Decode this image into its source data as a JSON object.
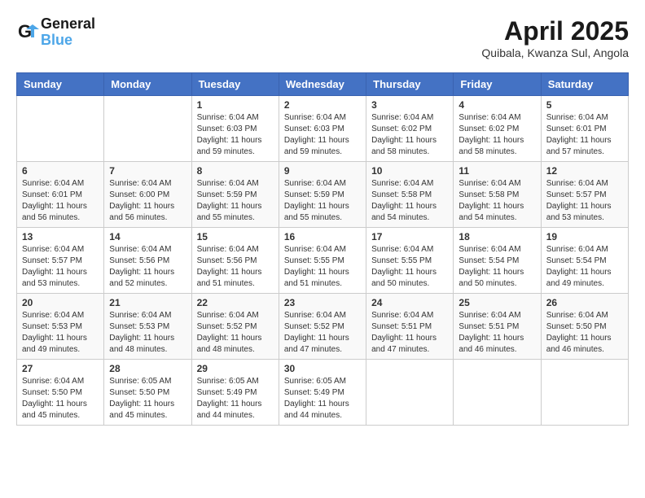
{
  "logo": {
    "line1": "General",
    "line2": "Blue"
  },
  "title": "April 2025",
  "location": "Quibala, Kwanza Sul, Angola",
  "days_of_week": [
    "Sunday",
    "Monday",
    "Tuesday",
    "Wednesday",
    "Thursday",
    "Friday",
    "Saturday"
  ],
  "weeks": [
    [
      {
        "day": "",
        "info": ""
      },
      {
        "day": "",
        "info": ""
      },
      {
        "day": "1",
        "info": "Sunrise: 6:04 AM\nSunset: 6:03 PM\nDaylight: 11 hours and 59 minutes."
      },
      {
        "day": "2",
        "info": "Sunrise: 6:04 AM\nSunset: 6:03 PM\nDaylight: 11 hours and 59 minutes."
      },
      {
        "day": "3",
        "info": "Sunrise: 6:04 AM\nSunset: 6:02 PM\nDaylight: 11 hours and 58 minutes."
      },
      {
        "day": "4",
        "info": "Sunrise: 6:04 AM\nSunset: 6:02 PM\nDaylight: 11 hours and 58 minutes."
      },
      {
        "day": "5",
        "info": "Sunrise: 6:04 AM\nSunset: 6:01 PM\nDaylight: 11 hours and 57 minutes."
      }
    ],
    [
      {
        "day": "6",
        "info": "Sunrise: 6:04 AM\nSunset: 6:01 PM\nDaylight: 11 hours and 56 minutes."
      },
      {
        "day": "7",
        "info": "Sunrise: 6:04 AM\nSunset: 6:00 PM\nDaylight: 11 hours and 56 minutes."
      },
      {
        "day": "8",
        "info": "Sunrise: 6:04 AM\nSunset: 5:59 PM\nDaylight: 11 hours and 55 minutes."
      },
      {
        "day": "9",
        "info": "Sunrise: 6:04 AM\nSunset: 5:59 PM\nDaylight: 11 hours and 55 minutes."
      },
      {
        "day": "10",
        "info": "Sunrise: 6:04 AM\nSunset: 5:58 PM\nDaylight: 11 hours and 54 minutes."
      },
      {
        "day": "11",
        "info": "Sunrise: 6:04 AM\nSunset: 5:58 PM\nDaylight: 11 hours and 54 minutes."
      },
      {
        "day": "12",
        "info": "Sunrise: 6:04 AM\nSunset: 5:57 PM\nDaylight: 11 hours and 53 minutes."
      }
    ],
    [
      {
        "day": "13",
        "info": "Sunrise: 6:04 AM\nSunset: 5:57 PM\nDaylight: 11 hours and 53 minutes."
      },
      {
        "day": "14",
        "info": "Sunrise: 6:04 AM\nSunset: 5:56 PM\nDaylight: 11 hours and 52 minutes."
      },
      {
        "day": "15",
        "info": "Sunrise: 6:04 AM\nSunset: 5:56 PM\nDaylight: 11 hours and 51 minutes."
      },
      {
        "day": "16",
        "info": "Sunrise: 6:04 AM\nSunset: 5:55 PM\nDaylight: 11 hours and 51 minutes."
      },
      {
        "day": "17",
        "info": "Sunrise: 6:04 AM\nSunset: 5:55 PM\nDaylight: 11 hours and 50 minutes."
      },
      {
        "day": "18",
        "info": "Sunrise: 6:04 AM\nSunset: 5:54 PM\nDaylight: 11 hours and 50 minutes."
      },
      {
        "day": "19",
        "info": "Sunrise: 6:04 AM\nSunset: 5:54 PM\nDaylight: 11 hours and 49 minutes."
      }
    ],
    [
      {
        "day": "20",
        "info": "Sunrise: 6:04 AM\nSunset: 5:53 PM\nDaylight: 11 hours and 49 minutes."
      },
      {
        "day": "21",
        "info": "Sunrise: 6:04 AM\nSunset: 5:53 PM\nDaylight: 11 hours and 48 minutes."
      },
      {
        "day": "22",
        "info": "Sunrise: 6:04 AM\nSunset: 5:52 PM\nDaylight: 11 hours and 48 minutes."
      },
      {
        "day": "23",
        "info": "Sunrise: 6:04 AM\nSunset: 5:52 PM\nDaylight: 11 hours and 47 minutes."
      },
      {
        "day": "24",
        "info": "Sunrise: 6:04 AM\nSunset: 5:51 PM\nDaylight: 11 hours and 47 minutes."
      },
      {
        "day": "25",
        "info": "Sunrise: 6:04 AM\nSunset: 5:51 PM\nDaylight: 11 hours and 46 minutes."
      },
      {
        "day": "26",
        "info": "Sunrise: 6:04 AM\nSunset: 5:50 PM\nDaylight: 11 hours and 46 minutes."
      }
    ],
    [
      {
        "day": "27",
        "info": "Sunrise: 6:04 AM\nSunset: 5:50 PM\nDaylight: 11 hours and 45 minutes."
      },
      {
        "day": "28",
        "info": "Sunrise: 6:05 AM\nSunset: 5:50 PM\nDaylight: 11 hours and 45 minutes."
      },
      {
        "day": "29",
        "info": "Sunrise: 6:05 AM\nSunset: 5:49 PM\nDaylight: 11 hours and 44 minutes."
      },
      {
        "day": "30",
        "info": "Sunrise: 6:05 AM\nSunset: 5:49 PM\nDaylight: 11 hours and 44 minutes."
      },
      {
        "day": "",
        "info": ""
      },
      {
        "day": "",
        "info": ""
      },
      {
        "day": "",
        "info": ""
      }
    ]
  ]
}
